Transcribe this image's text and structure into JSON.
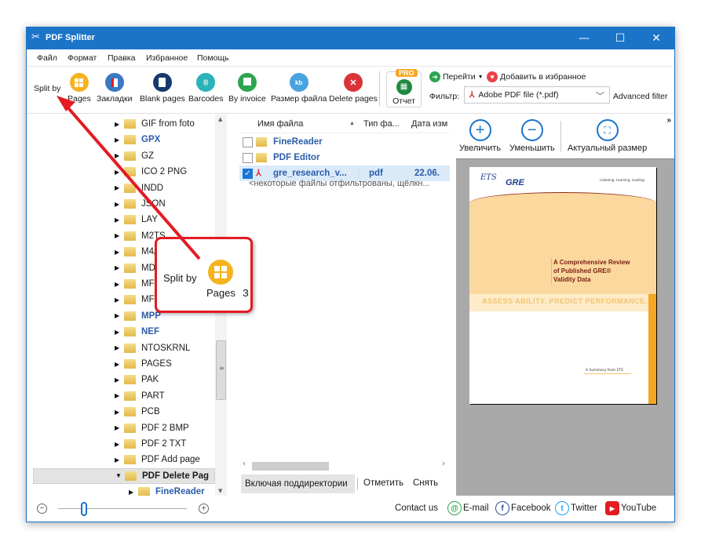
{
  "window": {
    "title": "PDF Splitter",
    "app_icon": "scissors-icon",
    "controls": {
      "minimize": "—",
      "maximize": "☐",
      "close": "✕"
    }
  },
  "menu": [
    "Файл",
    "Формат",
    "Правка",
    "Избранное",
    "Помощь"
  ],
  "toolbar": {
    "split_by_label": "Split by",
    "buttons": [
      {
        "label": "Pages",
        "icon": "pages-icon",
        "color": "#f5b31d"
      },
      {
        "label": "Закладки",
        "icon": "bookmark-icon",
        "color": "#3c78c3"
      },
      {
        "label": "Blank pages",
        "icon": "blank-page-icon",
        "color": "#143a6e"
      },
      {
        "label": "Barcodes",
        "icon": "barcode-icon",
        "color": "#2ab3b8"
      },
      {
        "label": "By invoice",
        "icon": "invoice-icon",
        "color": "#2ea44f"
      },
      {
        "label": "Размер файла",
        "icon": "file-size-icon",
        "color": "#4aa3df"
      },
      {
        "label": "Delete pages",
        "icon": "delete-pages-icon",
        "color": "#d9343a"
      }
    ],
    "report": {
      "label": "Отчет",
      "badge": "PRO"
    },
    "goto_label": "Перейти",
    "favorite_label": "Добавить в избранное",
    "filter_label": "Фильтр:",
    "filter_value": "Adobe PDF file (*.pdf)",
    "advanced_filter_label": "Advanced filter"
  },
  "tree": {
    "items": [
      {
        "label": "GIF from foto",
        "style": "normal"
      },
      {
        "label": "GPX",
        "style": "blue"
      },
      {
        "label": "GZ",
        "style": "normal"
      },
      {
        "label": "ICO 2 PNG",
        "style": "normal"
      },
      {
        "label": "INDD",
        "style": "normal"
      },
      {
        "label": "JSON",
        "style": "normal"
      },
      {
        "label": "LAY",
        "style": "normal"
      },
      {
        "label": "M2TS",
        "style": "normal"
      },
      {
        "label": "M4A",
        "style": "normal"
      },
      {
        "label": "MDS",
        "style": "normal"
      },
      {
        "label": "MFS",
        "style": "normal"
      },
      {
        "label": "MFS Volume",
        "style": "normal"
      },
      {
        "label": "MPP",
        "style": "blue"
      },
      {
        "label": "NEF",
        "style": "blue"
      },
      {
        "label": "NTOSKRNL",
        "style": "normal"
      },
      {
        "label": "PAGES",
        "style": "normal"
      },
      {
        "label": "PAK",
        "style": "normal"
      },
      {
        "label": "PART",
        "style": "normal"
      },
      {
        "label": "PCB",
        "style": "normal"
      },
      {
        "label": "PDF 2 BMP",
        "style": "normal"
      },
      {
        "label": "PDF 2 TXT",
        "style": "normal"
      },
      {
        "label": "PDF Add page",
        "style": "normal"
      },
      {
        "label": "PDF Delete Pag",
        "style": "selected"
      },
      {
        "label": "FineReader",
        "style": "child-blue"
      }
    ]
  },
  "files": {
    "columns": [
      "Имя файла",
      "Тип фа...",
      "Дата изм"
    ],
    "rows": [
      {
        "name": "FineReader",
        "type": "",
        "date": "",
        "kind": "folder",
        "checked": false
      },
      {
        "name": "PDF Editor",
        "type": "",
        "date": "",
        "kind": "folder",
        "checked": false
      },
      {
        "name": "gre_research_v...",
        "type": "pdf",
        "date": "22.06.",
        "kind": "pdf",
        "checked": true
      }
    ],
    "filtered_note": "<некоторые файлы отфильтрованы, щёлкн...",
    "footer": {
      "subdirs": "Включая поддиректории",
      "mark": "Отметить",
      "unmark": "Снять"
    }
  },
  "preview": {
    "zoom_in": "Увеличить",
    "zoom_out": "Уменьшить",
    "actual_size": "Актуальный размер",
    "more": "»",
    "document": {
      "logo": "ETS",
      "brand": "GRE",
      "tagline": "Listening. Learning. Leading.",
      "title_lines": [
        "A Comprehensive Review",
        "of Published GRE®",
        "Validity Data"
      ],
      "slogan": "ASSESS ABILITY. PREDICT PERFORMANCE.",
      "summary": "A Summary from ETS"
    }
  },
  "statusbar": {
    "zoom_level": 0.2,
    "contact_label": "Contact us",
    "links": [
      {
        "label": "E-mail",
        "icon": "email-icon",
        "glyph": "@",
        "color": "#2ea44f"
      },
      {
        "label": "Facebook",
        "icon": "facebook-icon",
        "glyph": "f",
        "color": "#2b4c8c"
      },
      {
        "label": "Twitter",
        "icon": "twitter-icon",
        "glyph": "t",
        "color": "#1da1f2"
      },
      {
        "label": "YouTube",
        "icon": "youtube-icon",
        "glyph": "▶",
        "color": "#e31b23"
      }
    ]
  },
  "callout": {
    "split_by": "Split by",
    "pages": "Pages",
    "cut_text": "З"
  }
}
